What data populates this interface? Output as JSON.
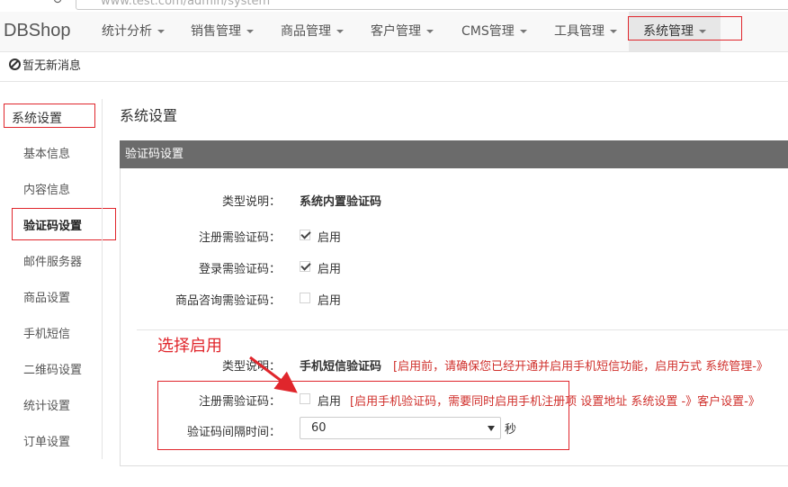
{
  "browser": {
    "url": "www.test.com/admin/system",
    "refresh_icon": "refresh-icon"
  },
  "brand": "DBShop",
  "nav": {
    "items": [
      {
        "label": "统计分析"
      },
      {
        "label": "销售管理"
      },
      {
        "label": "商品管理"
      },
      {
        "label": "客户管理"
      },
      {
        "label": "CMS管理"
      },
      {
        "label": "工具管理"
      },
      {
        "label": "系统管理"
      }
    ],
    "active_index": 6
  },
  "notice": {
    "text": "暂无新消息",
    "icon": "ban-icon"
  },
  "sidebar": {
    "heading": "系统设置",
    "items": [
      {
        "label": "基本信息"
      },
      {
        "label": "内容信息"
      },
      {
        "label": "验证码设置"
      },
      {
        "label": "邮件服务器"
      },
      {
        "label": "商品设置"
      },
      {
        "label": "手机短信"
      },
      {
        "label": "二维码设置"
      },
      {
        "label": "统计设置"
      },
      {
        "label": "订单设置"
      }
    ],
    "active_index": 2
  },
  "page_title": "系统设置",
  "panel": {
    "title": "验证码设置",
    "system_section": {
      "type_label": "类型说明：",
      "type_value": "系统内置验证码",
      "rows": [
        {
          "label": "注册需验证码：",
          "checkbox_label": "启用",
          "checked": true
        },
        {
          "label": "登录需验证码：",
          "checkbox_label": "启用",
          "checked": true
        },
        {
          "label": "商品咨询需验证码：",
          "checkbox_label": "启用",
          "checked": false
        }
      ]
    },
    "sms_section": {
      "type_label": "类型说明：",
      "type_value": "手机短信验证码",
      "type_note": "[启用前，请确保您已经开通并启用手机短信功能，启用方式 系统管理-》",
      "register_label": "注册需验证码：",
      "register_checkbox_label": "启用",
      "register_checked": false,
      "register_note": "[启用手机验证码，需要同时启用手机注册项 设置地址 系统设置 -》客户设置-》",
      "interval_label": "验证码间隔时间：",
      "interval_value": "60",
      "interval_unit": "秒"
    }
  },
  "annotation": {
    "text": "选择启用",
    "color": "#e0262c"
  },
  "colors": {
    "accent_red": "#e0262c",
    "note_red": "#d0312d",
    "panel_header": "#6b6b6b"
  }
}
